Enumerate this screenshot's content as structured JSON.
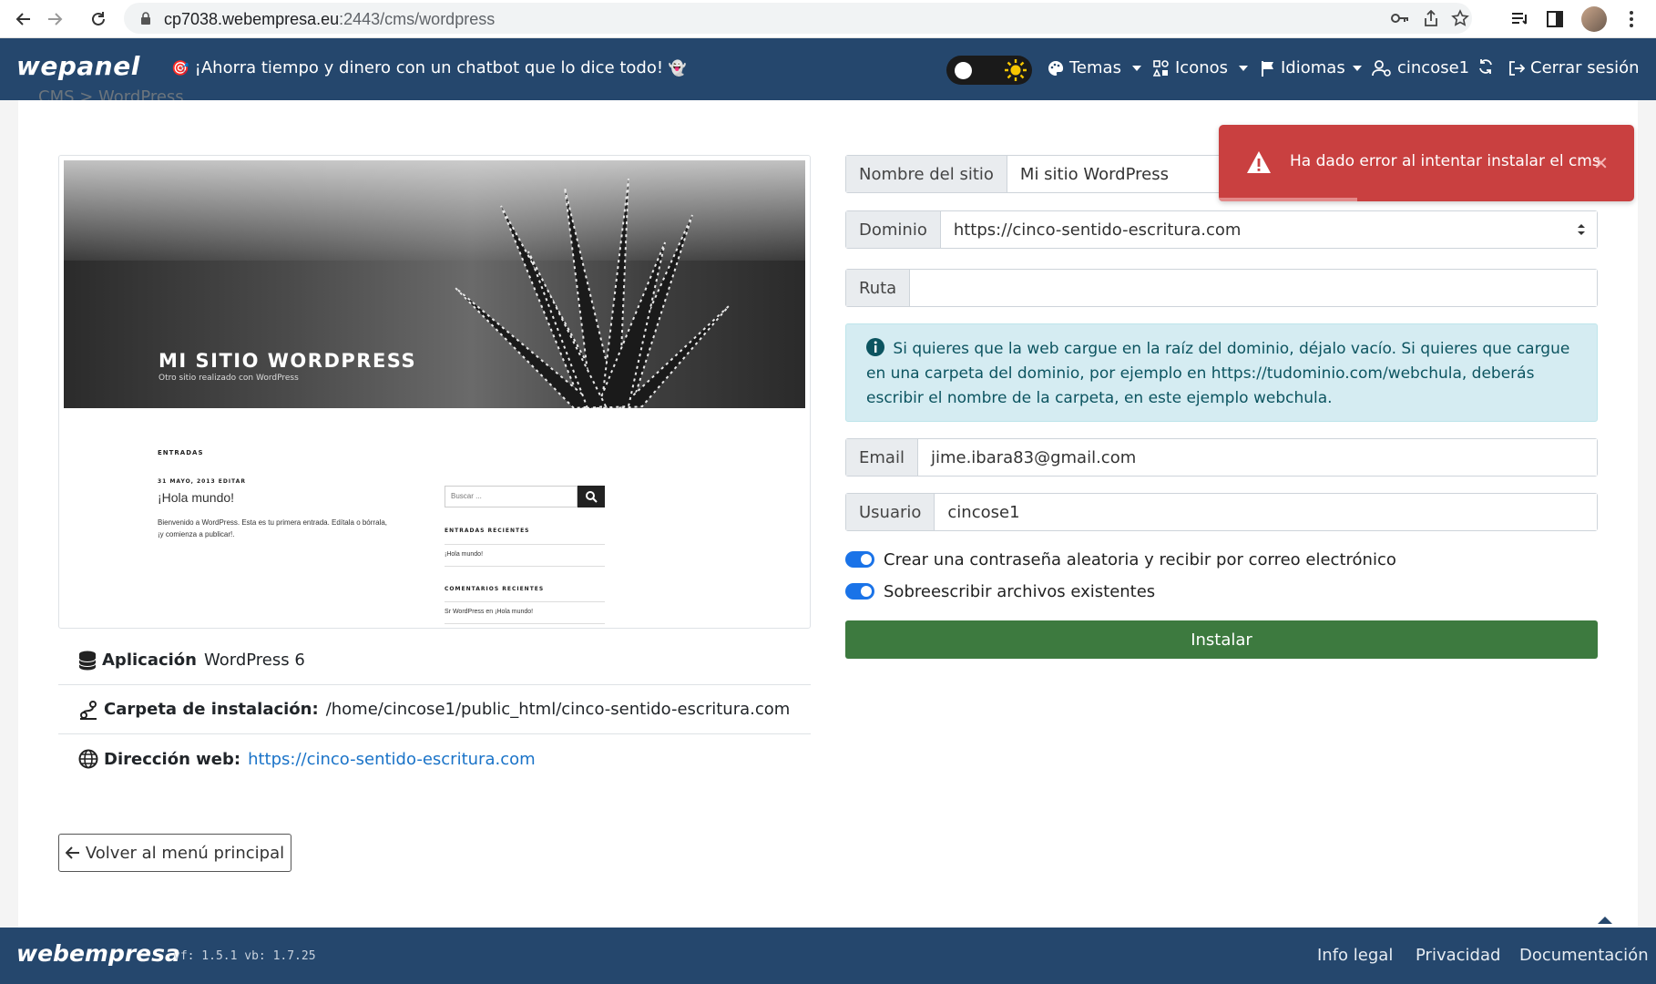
{
  "browser": {
    "url_host": "cp7038.webempresa.eu",
    "url_rest": ":2443/cms/wordpress"
  },
  "header": {
    "logo": "wepanel",
    "promo_text": "¡Ahorra tiempo y dinero con un chatbot que lo dice todo!",
    "temas": "Temas",
    "iconos": "Iconos",
    "idiomas": "Idiomas",
    "user": "cincose1",
    "logout": "Cerrar sesión"
  },
  "breadcrumb": "CMS > WordPress",
  "preview": {
    "site_title": "MI SITIO WORDPRESS",
    "site_tagline": "Otro sitio realizado con WordPress",
    "entries_label": "ENTRADAS",
    "post_meta": "31 MAYO, 2013   EDITAR",
    "post_title": "¡Hola mundo!",
    "post_body_1": "Bienvenido a WordPress. Esta es tu primera entrada. Edítala o bórrala,",
    "post_body_2": "¡y comienza a publicar!.",
    "search_placeholder": "Buscar ...",
    "recent_posts_label": "ENTRADAS RECIENTES",
    "recent_post_1": "¡Hola mundo!",
    "recent_comments_label": "COMENTARIOS RECIENTES",
    "recent_comment_1": "Sr WordPress en ¡Hola mundo!"
  },
  "info": {
    "app_label": "Aplicación",
    "app_value": "WordPress 6",
    "folder_label": "Carpeta de instalación:",
    "folder_value": "/home/cincose1/public_html/cinco-sentido-escritura.com",
    "web_label": "Dirección web:",
    "web_value": "https://cinco-sentido-escritura.com"
  },
  "back_button": "Volver al menú principal",
  "form": {
    "site_name_label": "Nombre del sitio",
    "site_name_value": "Mi sitio WordPress",
    "domain_label": "Dominio",
    "domain_value": "https://cinco-sentido-escritura.com",
    "path_label": "Ruta",
    "path_value": "",
    "info_text": "Si quieres que la web cargue en la raíz del dominio, déjalo vacío. Si quieres que cargue en una carpeta del dominio, por ejemplo en https://tudominio.com/webchula, deberás escribir el nombre de la carpeta, en este ejemplo webchula.",
    "email_label": "Email",
    "email_value": "jime.ibara83@gmail.com",
    "user_label": "Usuario",
    "user_value": "cincose1",
    "toggle_password": "Crear una contraseña aleatoria y recibir por correo electrónico",
    "toggle_overwrite": "Sobreescribir archivos existentes",
    "install_button": "Instalar"
  },
  "toast": {
    "message": "Ha dado error al intentar instalar el cms"
  },
  "footer": {
    "logo": "webempresa",
    "version": "vf: 1.5.1 vb: 1.7.25",
    "legal": "Info legal",
    "privacy": "Privacidad",
    "docs": "Documentación"
  },
  "colors": {
    "header_bg": "#25476d",
    "install_green": "#3d7a3f",
    "toast_red": "#c94040",
    "info_bg": "#d5ecf2",
    "switch_blue": "#1a73e8"
  }
}
